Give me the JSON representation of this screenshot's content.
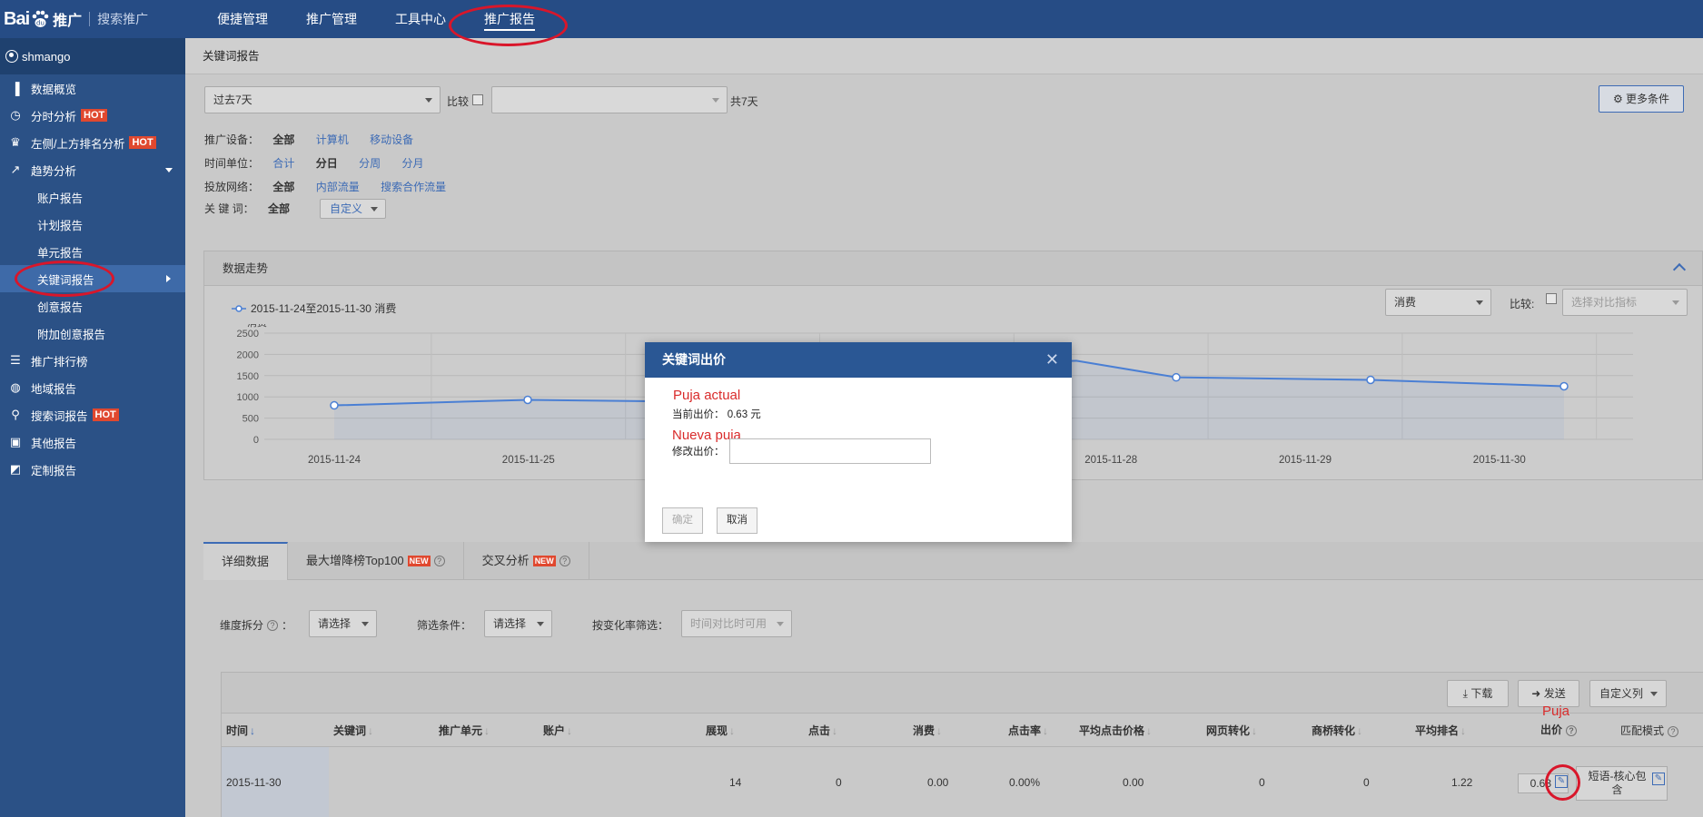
{
  "header": {
    "brand_left": "Bai",
    "brand_right": "推广",
    "subtitle": "搜索推广",
    "nav": [
      "便捷管理",
      "推广管理",
      "工具中心",
      "推广报告"
    ]
  },
  "sidebar": {
    "user": "shmango",
    "items": [
      {
        "label": "数据概览",
        "hot": ""
      },
      {
        "label": "分时分析",
        "hot": "HOT"
      },
      {
        "label": "左侧/上方排名分析",
        "hot": "HOT"
      },
      {
        "label": "趋势分析",
        "hot": ""
      }
    ],
    "sub_items": [
      "账户报告",
      "计划报告",
      "单元报告",
      "关键词报告",
      "创意报告",
      "附加创意报告"
    ],
    "items2": [
      {
        "label": "推广排行榜",
        "hot": ""
      },
      {
        "label": "地域报告",
        "hot": ""
      },
      {
        "label": "搜索词报告",
        "hot": "HOT"
      },
      {
        "label": "其他报告",
        "hot": ""
      },
      {
        "label": "定制报告",
        "hot": ""
      }
    ]
  },
  "page": {
    "title": "关键词报告",
    "date_range": "过去7天",
    "compare_label": "比较",
    "days_total": "共7天",
    "more_conditions": "更多条件"
  },
  "filters": {
    "device_label": "推广设备：",
    "device_options": [
      "全部",
      "计算机",
      "移动设备"
    ],
    "time_label": "时间单位：",
    "time_options": [
      "合计",
      "分日",
      "分周",
      "分月"
    ],
    "network_label": "投放网络：",
    "network_options": [
      "全部",
      "内部流量",
      "搜索合作流量"
    ],
    "keyword_label": "关 键 词：",
    "keyword_all": "全部",
    "keyword_custom": "自定义"
  },
  "trend": {
    "title": "数据走势",
    "metric_select": "消费",
    "compare_label": "比较:",
    "compare_placeholder": "选择对比指标"
  },
  "chart_data": {
    "type": "line",
    "series": [
      {
        "name": "2015-11-24至2015-11-30 消费",
        "values": [
          800,
          930,
          880,
          1700,
          1850,
          1460,
          1400,
          1250
        ]
      }
    ],
    "categories": [
      "2015-11-24",
      "2015-11-25",
      "2015-11-26",
      "2015-11-27",
      "2015-11-27b",
      "2015-11-28",
      "2015-11-29",
      "2015-11-30"
    ],
    "x_labels": [
      "2015-11-24",
      "2015-11-25",
      "2015-11-28",
      "2015-11-29",
      "2015-11-30"
    ],
    "ylabel": "消费",
    "yticks": [
      0,
      500,
      1000,
      1500,
      2000,
      2500
    ],
    "ylim": [
      0,
      2500
    ],
    "grid": true,
    "color": "#4a7fd4"
  },
  "tabs": [
    {
      "label": "详细数据",
      "badge": "",
      "help": false
    },
    {
      "label": "最大增降榜Top100",
      "badge": "NEW",
      "help": true
    },
    {
      "label": "交叉分析",
      "badge": "NEW",
      "help": true
    }
  ],
  "detail": {
    "dimension_label": "维度拆分",
    "dimension_select": "请选择",
    "filter_label": "筛选条件：",
    "filter_select": "请选择",
    "rate_label": "按变化率筛选：",
    "rate_select": "时间对比时可用",
    "download": "下载",
    "send": "发送",
    "custom_cols": "自定义列"
  },
  "table": {
    "headers": [
      "时间",
      "关键词",
      "推广单元",
      "账户",
      "展现",
      "点击",
      "消费",
      "点击率",
      "平均点击价格",
      "网页转化",
      "商桥转化",
      "平均排名",
      "出价",
      "匹配模式"
    ],
    "row": {
      "date": "2015-11-30",
      "impressions": "14",
      "clicks": "0",
      "cost": "0.00",
      "ctr": "0.00%",
      "cpc": "0.00",
      "web_conv": "0",
      "bridge_conv": "0",
      "avg_rank": "1.22",
      "bid": "0.63",
      "match": "短语-核心包含"
    }
  },
  "modal": {
    "title": "关键词出价",
    "current_label": "当前出价：",
    "current_value": "0.63 元",
    "edit_label": "修改出价：",
    "confirm": "确定",
    "cancel": "取消"
  },
  "annotations": {
    "current": "Puja actual",
    "new": "Nueva puja",
    "bid": "Puja"
  }
}
